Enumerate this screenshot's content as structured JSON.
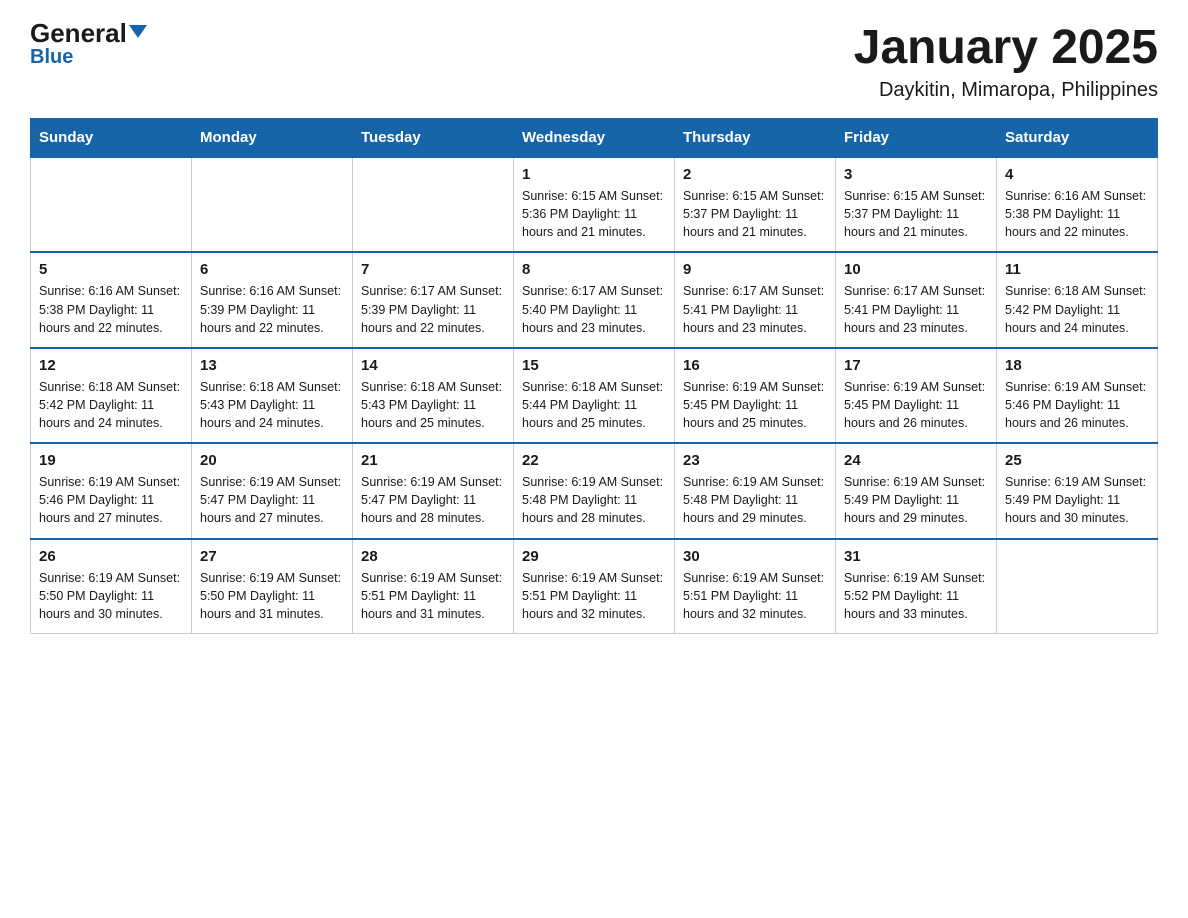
{
  "logo": {
    "general": "General",
    "blue": "Blue",
    "triangle": "▼"
  },
  "title": "January 2025",
  "subtitle": "Daykitin, Mimaropa, Philippines",
  "days": [
    "Sunday",
    "Monday",
    "Tuesday",
    "Wednesday",
    "Thursday",
    "Friday",
    "Saturday"
  ],
  "weeks": [
    [
      {
        "day": "",
        "info": ""
      },
      {
        "day": "",
        "info": ""
      },
      {
        "day": "",
        "info": ""
      },
      {
        "day": "1",
        "info": "Sunrise: 6:15 AM\nSunset: 5:36 PM\nDaylight: 11 hours\nand 21 minutes."
      },
      {
        "day": "2",
        "info": "Sunrise: 6:15 AM\nSunset: 5:37 PM\nDaylight: 11 hours\nand 21 minutes."
      },
      {
        "day": "3",
        "info": "Sunrise: 6:15 AM\nSunset: 5:37 PM\nDaylight: 11 hours\nand 21 minutes."
      },
      {
        "day": "4",
        "info": "Sunrise: 6:16 AM\nSunset: 5:38 PM\nDaylight: 11 hours\nand 22 minutes."
      }
    ],
    [
      {
        "day": "5",
        "info": "Sunrise: 6:16 AM\nSunset: 5:38 PM\nDaylight: 11 hours\nand 22 minutes."
      },
      {
        "day": "6",
        "info": "Sunrise: 6:16 AM\nSunset: 5:39 PM\nDaylight: 11 hours\nand 22 minutes."
      },
      {
        "day": "7",
        "info": "Sunrise: 6:17 AM\nSunset: 5:39 PM\nDaylight: 11 hours\nand 22 minutes."
      },
      {
        "day": "8",
        "info": "Sunrise: 6:17 AM\nSunset: 5:40 PM\nDaylight: 11 hours\nand 23 minutes."
      },
      {
        "day": "9",
        "info": "Sunrise: 6:17 AM\nSunset: 5:41 PM\nDaylight: 11 hours\nand 23 minutes."
      },
      {
        "day": "10",
        "info": "Sunrise: 6:17 AM\nSunset: 5:41 PM\nDaylight: 11 hours\nand 23 minutes."
      },
      {
        "day": "11",
        "info": "Sunrise: 6:18 AM\nSunset: 5:42 PM\nDaylight: 11 hours\nand 24 minutes."
      }
    ],
    [
      {
        "day": "12",
        "info": "Sunrise: 6:18 AM\nSunset: 5:42 PM\nDaylight: 11 hours\nand 24 minutes."
      },
      {
        "day": "13",
        "info": "Sunrise: 6:18 AM\nSunset: 5:43 PM\nDaylight: 11 hours\nand 24 minutes."
      },
      {
        "day": "14",
        "info": "Sunrise: 6:18 AM\nSunset: 5:43 PM\nDaylight: 11 hours\nand 25 minutes."
      },
      {
        "day": "15",
        "info": "Sunrise: 6:18 AM\nSunset: 5:44 PM\nDaylight: 11 hours\nand 25 minutes."
      },
      {
        "day": "16",
        "info": "Sunrise: 6:19 AM\nSunset: 5:45 PM\nDaylight: 11 hours\nand 25 minutes."
      },
      {
        "day": "17",
        "info": "Sunrise: 6:19 AM\nSunset: 5:45 PM\nDaylight: 11 hours\nand 26 minutes."
      },
      {
        "day": "18",
        "info": "Sunrise: 6:19 AM\nSunset: 5:46 PM\nDaylight: 11 hours\nand 26 minutes."
      }
    ],
    [
      {
        "day": "19",
        "info": "Sunrise: 6:19 AM\nSunset: 5:46 PM\nDaylight: 11 hours\nand 27 minutes."
      },
      {
        "day": "20",
        "info": "Sunrise: 6:19 AM\nSunset: 5:47 PM\nDaylight: 11 hours\nand 27 minutes."
      },
      {
        "day": "21",
        "info": "Sunrise: 6:19 AM\nSunset: 5:47 PM\nDaylight: 11 hours\nand 28 minutes."
      },
      {
        "day": "22",
        "info": "Sunrise: 6:19 AM\nSunset: 5:48 PM\nDaylight: 11 hours\nand 28 minutes."
      },
      {
        "day": "23",
        "info": "Sunrise: 6:19 AM\nSunset: 5:48 PM\nDaylight: 11 hours\nand 29 minutes."
      },
      {
        "day": "24",
        "info": "Sunrise: 6:19 AM\nSunset: 5:49 PM\nDaylight: 11 hours\nand 29 minutes."
      },
      {
        "day": "25",
        "info": "Sunrise: 6:19 AM\nSunset: 5:49 PM\nDaylight: 11 hours\nand 30 minutes."
      }
    ],
    [
      {
        "day": "26",
        "info": "Sunrise: 6:19 AM\nSunset: 5:50 PM\nDaylight: 11 hours\nand 30 minutes."
      },
      {
        "day": "27",
        "info": "Sunrise: 6:19 AM\nSunset: 5:50 PM\nDaylight: 11 hours\nand 31 minutes."
      },
      {
        "day": "28",
        "info": "Sunrise: 6:19 AM\nSunset: 5:51 PM\nDaylight: 11 hours\nand 31 minutes."
      },
      {
        "day": "29",
        "info": "Sunrise: 6:19 AM\nSunset: 5:51 PM\nDaylight: 11 hours\nand 32 minutes."
      },
      {
        "day": "30",
        "info": "Sunrise: 6:19 AM\nSunset: 5:51 PM\nDaylight: 11 hours\nand 32 minutes."
      },
      {
        "day": "31",
        "info": "Sunrise: 6:19 AM\nSunset: 5:52 PM\nDaylight: 11 hours\nand 33 minutes."
      },
      {
        "day": "",
        "info": ""
      }
    ]
  ]
}
